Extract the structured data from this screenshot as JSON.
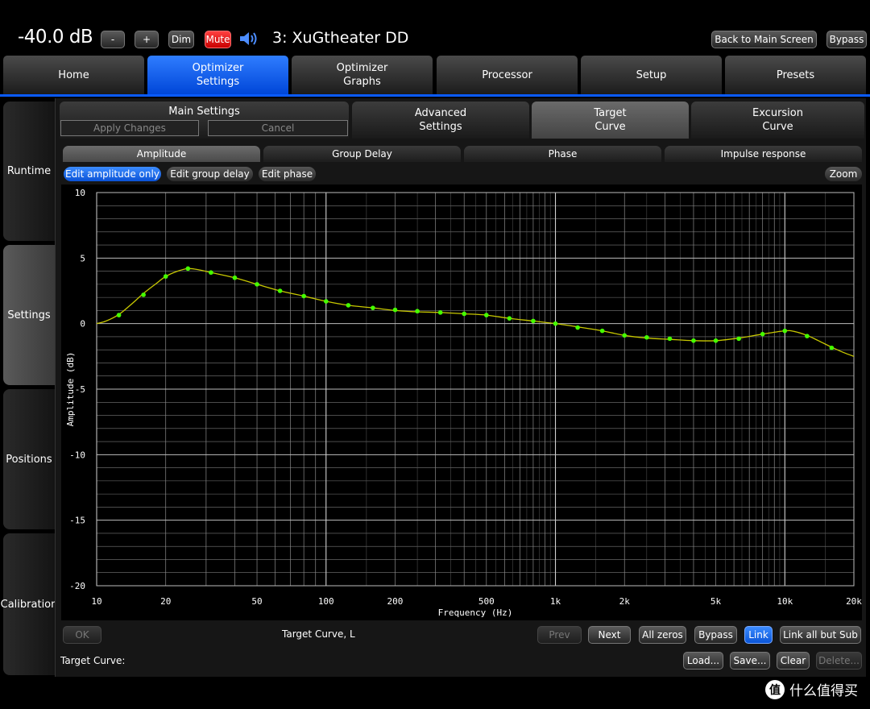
{
  "header": {
    "volume": "-40.0 dB",
    "minus_label": "-",
    "plus_label": "+",
    "dim_label": "Dim",
    "mute_label": "Mute",
    "preset_name": "3: XuGtheater DD",
    "back_label": "Back to Main Screen",
    "bypass_label": "Bypass"
  },
  "main_tabs": [
    {
      "label": "Home"
    },
    {
      "label": "Optimizer\nSettings"
    },
    {
      "label": "Optimizer\nGraphs"
    },
    {
      "label": "Processor"
    },
    {
      "label": "Setup"
    },
    {
      "label": "Presets"
    }
  ],
  "side_nav": [
    {
      "label": "Runtime"
    },
    {
      "label": "Settings"
    },
    {
      "label": "Positions"
    },
    {
      "label": "Calibration"
    }
  ],
  "sub_tabs": {
    "main_settings": "Main Settings",
    "apply_changes": "Apply Changes",
    "cancel": "Cancel",
    "advanced": "Advanced\nSettings",
    "target": "Target\nCurve",
    "excursion": "Excursion\nCurve"
  },
  "graph_tabs": [
    {
      "label": "Amplitude"
    },
    {
      "label": "Group Delay"
    },
    {
      "label": "Phase"
    },
    {
      "label": "Impulse response"
    }
  ],
  "edit_modes": {
    "amplitude_only": "Edit amplitude only",
    "group_delay": "Edit group delay",
    "phase": "Edit phase",
    "zoom": "Zoom"
  },
  "chart_data": {
    "type": "line",
    "xlabel": "Frequency (Hz)",
    "ylabel": "Amplitude (dB)",
    "x_scale": "log",
    "xlim": [
      10,
      20000
    ],
    "ylim": [
      -20,
      10
    ],
    "y_ticks": [
      10,
      5,
      0,
      -5,
      -10,
      -15,
      -20
    ],
    "x_ticks": [
      {
        "value": 10,
        "label": "10"
      },
      {
        "value": 20,
        "label": "20"
      },
      {
        "value": 50,
        "label": "50"
      },
      {
        "value": 100,
        "label": "100"
      },
      {
        "value": 200,
        "label": "200"
      },
      {
        "value": 500,
        "label": "500"
      },
      {
        "value": 1000,
        "label": "1k"
      },
      {
        "value": 2000,
        "label": "2k"
      },
      {
        "value": 5000,
        "label": "5k"
      },
      {
        "value": 10000,
        "label": "10k"
      },
      {
        "value": 20000,
        "label": "20k"
      }
    ],
    "grid": true,
    "line_color": "#c8c800",
    "point_color": "#44ff00",
    "curve": [
      [
        10,
        0.0
      ],
      [
        11,
        0.2
      ],
      [
        12.5,
        0.7
      ],
      [
        14,
        1.4
      ],
      [
        16,
        2.3
      ],
      [
        18,
        3.0
      ],
      [
        20,
        3.6
      ],
      [
        22.5,
        4.0
      ],
      [
        25,
        4.2
      ],
      [
        28,
        4.1
      ],
      [
        31.5,
        3.9
      ],
      [
        40,
        3.5
      ],
      [
        50,
        3.0
      ],
      [
        63,
        2.5
      ],
      [
        80,
        2.1
      ],
      [
        100,
        1.7
      ],
      [
        125,
        1.4
      ],
      [
        160,
        1.2
      ],
      [
        200,
        1.0
      ],
      [
        250,
        0.9
      ],
      [
        315,
        0.85
      ],
      [
        400,
        0.75
      ],
      [
        500,
        0.65
      ],
      [
        630,
        0.4
      ],
      [
        800,
        0.2
      ],
      [
        1000,
        0.0
      ],
      [
        1250,
        -0.25
      ],
      [
        1600,
        -0.55
      ],
      [
        2000,
        -0.9
      ],
      [
        2500,
        -1.1
      ],
      [
        3150,
        -1.2
      ],
      [
        4000,
        -1.3
      ],
      [
        5000,
        -1.3
      ],
      [
        6300,
        -1.1
      ],
      [
        8000,
        -0.8
      ],
      [
        10000,
        -0.55
      ],
      [
        11000,
        -0.6
      ],
      [
        12500,
        -0.9
      ],
      [
        14000,
        -1.3
      ],
      [
        16000,
        -1.8
      ],
      [
        18000,
        -2.2
      ],
      [
        20000,
        -2.5
      ]
    ],
    "points": [
      [
        12.5,
        0.65
      ],
      [
        16,
        2.2
      ],
      [
        20,
        3.6
      ],
      [
        25,
        4.2
      ],
      [
        31.5,
        3.9
      ],
      [
        40,
        3.5
      ],
      [
        50,
        3.0
      ],
      [
        63,
        2.5
      ],
      [
        80,
        2.1
      ],
      [
        100,
        1.7
      ],
      [
        125,
        1.4
      ],
      [
        160,
        1.2
      ],
      [
        200,
        1.05
      ],
      [
        250,
        0.95
      ],
      [
        315,
        0.85
      ],
      [
        400,
        0.75
      ],
      [
        500,
        0.65
      ],
      [
        630,
        0.4
      ],
      [
        800,
        0.2
      ],
      [
        1000,
        0.0
      ],
      [
        1250,
        -0.3
      ],
      [
        1600,
        -0.55
      ],
      [
        2000,
        -0.9
      ],
      [
        2500,
        -1.05
      ],
      [
        3150,
        -1.15
      ],
      [
        4000,
        -1.3
      ],
      [
        5000,
        -1.3
      ],
      [
        6300,
        -1.15
      ],
      [
        8000,
        -0.8
      ],
      [
        10000,
        -0.55
      ],
      [
        12500,
        -0.95
      ],
      [
        16000,
        -1.85
      ]
    ]
  },
  "footer": {
    "ok": "OK",
    "curve_label": "Target Curve, L",
    "prev": "Prev",
    "next": "Next",
    "all_zeros": "All zeros",
    "bypass": "Bypass",
    "link": "Link",
    "link_all_but_sub": "Link all but Sub",
    "target_curve_label": "Target Curve:",
    "load": "Load...",
    "save": "Save...",
    "clear": "Clear",
    "delete": "Delete..."
  },
  "watermark": {
    "icon": "值",
    "text": "什么值得买"
  }
}
